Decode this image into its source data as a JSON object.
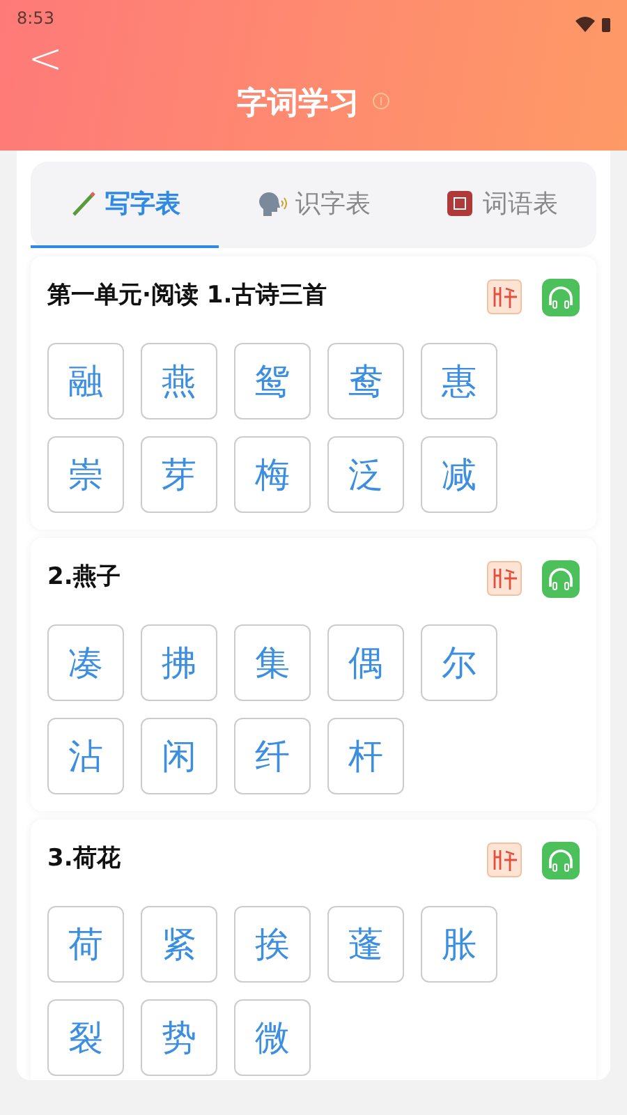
{
  "status_bar": {
    "time": "8:53"
  },
  "header": {
    "back": "<",
    "title": "字词学习"
  },
  "tabs": [
    {
      "label": "写字表",
      "selected": true
    },
    {
      "label": "识字表",
      "selected": false
    },
    {
      "label": "词语表",
      "selected": false
    }
  ],
  "sections": [
    {
      "title": "第一单元·阅读 1.古诗三首",
      "characters": [
        "融",
        "燕",
        "鸳",
        "鸯",
        "惠",
        "崇",
        "芽",
        "梅",
        "泛",
        "减"
      ]
    },
    {
      "title": "2.燕子",
      "characters": [
        "凑",
        "拂",
        "集",
        "偶",
        "尔",
        "沾",
        "闲",
        "纤",
        "杆"
      ]
    },
    {
      "title": "3.荷花",
      "characters": [
        "荷",
        "紧",
        "挨",
        "蓬",
        "胀",
        "裂",
        "势",
        "微"
      ]
    }
  ]
}
